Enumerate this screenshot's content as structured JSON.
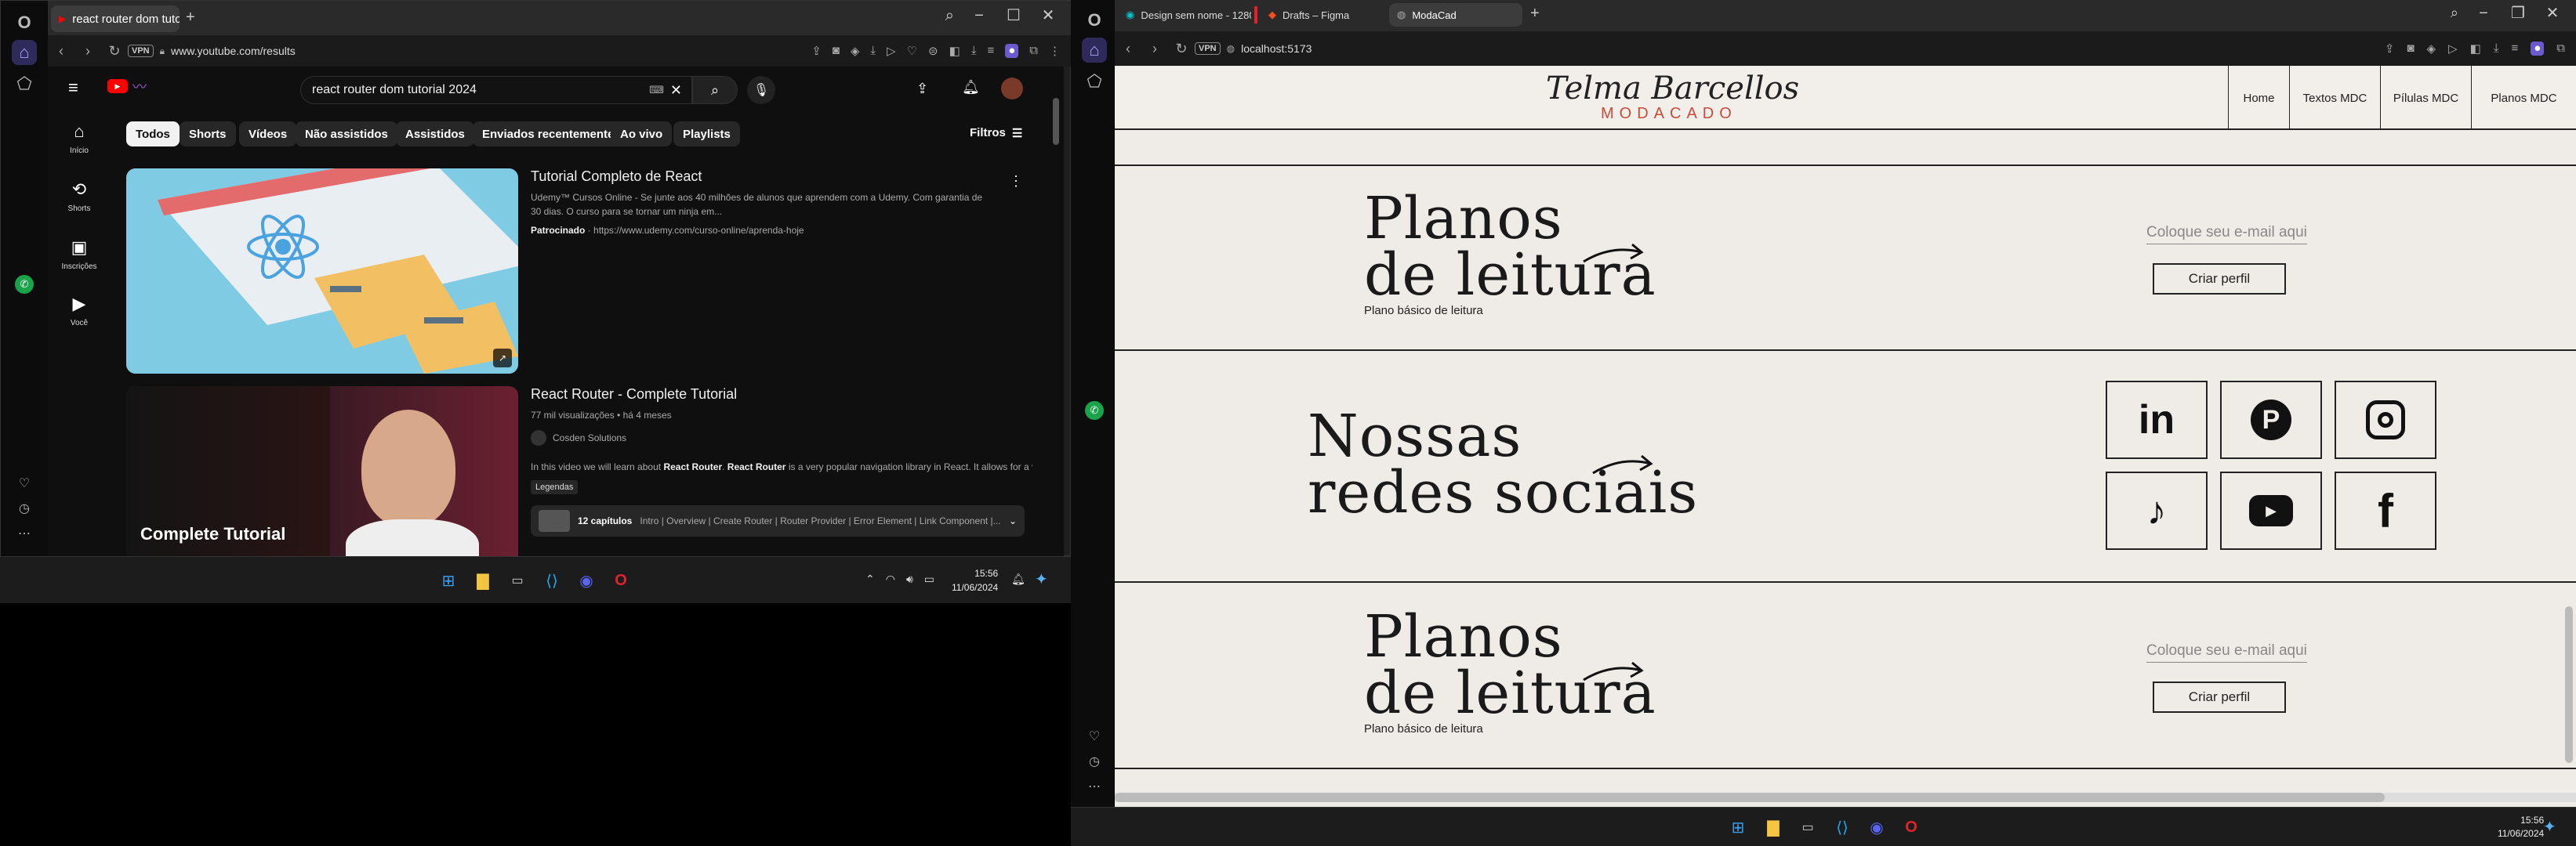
{
  "left": {
    "tab_title": "react router dom tutorial",
    "url": "www.youtube.com/results",
    "vpn": "VPN",
    "search_query": "react router dom tutorial 2024",
    "sidebar": [
      {
        "label": "Início",
        "icon": "home-icon"
      },
      {
        "label": "Shorts",
        "icon": "shorts-icon"
      },
      {
        "label": "Inscrições",
        "icon": "subscriptions-icon"
      },
      {
        "label": "Você",
        "icon": "you-icon"
      }
    ],
    "chips": [
      "Todos",
      "Shorts",
      "Vídeos",
      "Não assistidos",
      "Assistidos",
      "Enviados recentemente",
      "Ao vivo",
      "Playlists"
    ],
    "filters_label": "Filtros",
    "ad": {
      "title": "Tutorial Completo de React",
      "desc": "Udemy™ Cursos Online - Se junte aos 40 milhões de alunos que aprendem com a Udemy. Com garantia de 30 dias. O curso para se tornar um ninja em...",
      "sponsored": "Patrocinado",
      "link": "https://www.udemy.com/curso-online/aprenda-hoje"
    },
    "video": {
      "title": "React Router - Complete Tutorial",
      "views": "77 mil visualizações • há 4 meses",
      "channel": "Cosden Solutions",
      "desc_pre": "In this video we will learn about ",
      "desc_b1": "React Router",
      "desc_mid": ". ",
      "desc_b2": "React Router",
      "desc_post": " is a very popular navigation library in React. It allows for a v...",
      "badge": "Legendas",
      "chapters_count": "12 capítulos",
      "chapters": "Intro | Overview | Create Router | Router Provider | Error Element | Link Component |...",
      "thumb_caption": "Complete Tutorial"
    },
    "clock_time": "15:56",
    "clock_date": "11/06/2024"
  },
  "right": {
    "tabs": [
      "Design sem nome - 1280...",
      "Drafts – Figma",
      "ModaCad"
    ],
    "url": "localhost:5173",
    "vpn": "VPN",
    "logo_script": "Telma Barcellos",
    "logo_caps": "MODACADO",
    "nav": [
      "Home",
      "Textos MDC",
      "Pílulas MDC",
      "Planos MDC"
    ],
    "planos_title_1": "Planos",
    "planos_title_2": "de leitura",
    "planos_sub": "Plano básico de leitura",
    "email_placeholder": "Coloque seu e-mail aqui",
    "criar_perfil": "Criar perfil",
    "redes_title_1": "Nossas",
    "redes_title_2": "redes sociais",
    "social": [
      "linkedin-icon",
      "pinterest-icon",
      "instagram-icon",
      "tiktok-icon",
      "youtube-icon",
      "facebook-icon"
    ],
    "clock_time": "15:56",
    "clock_date": "11/06/2024"
  },
  "colors": {
    "opera_red": "#e0242b",
    "yt_red": "#ff0000",
    "site_bg": "#efebe6",
    "accent": "#c94b3a"
  }
}
